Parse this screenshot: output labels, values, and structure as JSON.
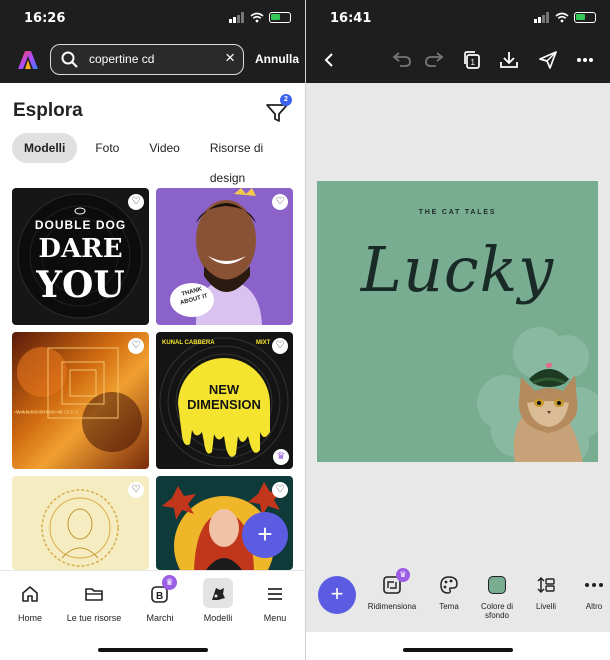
{
  "left_screen": {
    "status_time": "16:26",
    "search": {
      "value": "copertine cd",
      "cancel_label": "Annulla"
    },
    "page_title": "Esplora",
    "filter_count": "2",
    "tabs": [
      "Modelli",
      "Foto",
      "Video",
      "Risorse di design"
    ],
    "templates": [
      {
        "line1": "DOUBLE DOG",
        "line2": "DARE",
        "line3": "YOU"
      },
      {
        "sign_text": "THANK ABOUT IT"
      },
      {
        "caption": "WANDERING MINDS"
      },
      {
        "artist": "KUNAL CABBERA",
        "tag": "MIXT",
        "title": "NEW DIMENSION"
      },
      {
        "caption": ""
      },
      {
        "caption": ""
      }
    ],
    "fab_label": "+",
    "nav": [
      {
        "label": "Home",
        "icon": "home-icon"
      },
      {
        "label": "Le tue risorse",
        "icon": "folder-icon"
      },
      {
        "label": "Marchi",
        "icon": "brand-icon"
      },
      {
        "label": "Modelli",
        "icon": "templates-icon"
      },
      {
        "label": "Menu",
        "icon": "menu-icon"
      }
    ]
  },
  "right_screen": {
    "status_time": "16:41",
    "canvas": {
      "subtitle": "THE CAT TALES",
      "title": "Lucky",
      "background": "#78ad92"
    },
    "fab_label": "+",
    "tools": [
      {
        "label": "Ridimensiona",
        "icon": "resize-icon",
        "premium": true
      },
      {
        "label": "Tema",
        "icon": "palette-icon"
      },
      {
        "label": "Colore di sfondo",
        "icon": "background-color-icon"
      },
      {
        "label": "Livelli",
        "icon": "layers-icon"
      },
      {
        "label": "Altro",
        "icon": "more-icon"
      }
    ]
  },
  "colors": {
    "accent": "#5b5ce2",
    "premium": "#9b5de5",
    "header": "#1e1e1e"
  }
}
